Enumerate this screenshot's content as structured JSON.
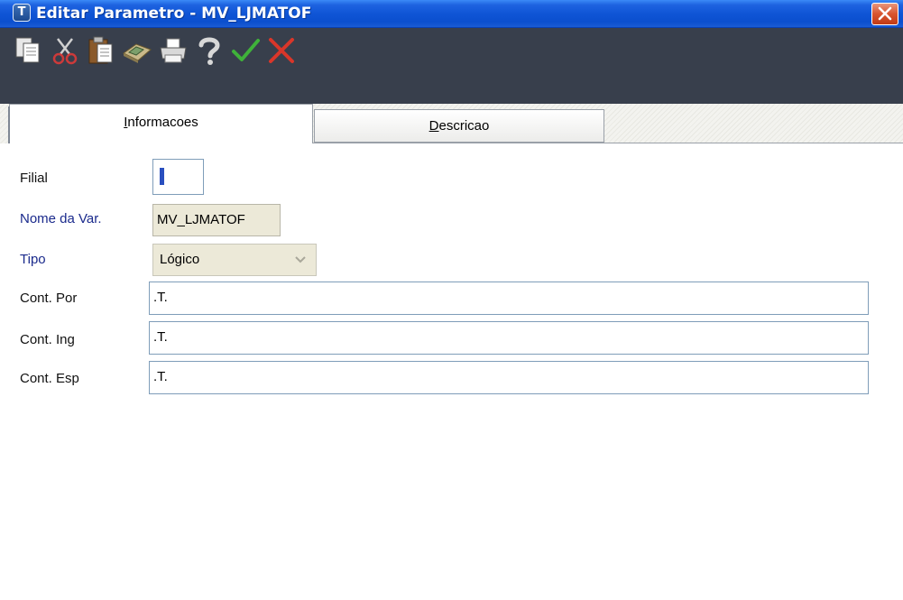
{
  "window": {
    "title": "Editar Parametro - MV_LJMATOF",
    "app_icon_glyph": "T"
  },
  "toolbar": {
    "buttons": [
      {
        "name": "copy-icon"
      },
      {
        "name": "cut-icon"
      },
      {
        "name": "paste-icon"
      },
      {
        "name": "calculator-icon"
      },
      {
        "name": "print-icon"
      },
      {
        "name": "help-icon"
      },
      {
        "name": "confirm-icon",
        "color": "#3fb23a"
      },
      {
        "name": "cancel-icon",
        "color": "#d9362a"
      }
    ]
  },
  "tabs": [
    {
      "label_pre": "",
      "label_mnemonic": "I",
      "label_post": "nformacoes",
      "active": true
    },
    {
      "label_pre": "",
      "label_mnemonic": "D",
      "label_post": "escricao",
      "active": false
    }
  ],
  "form": {
    "filial": {
      "label": "Filial",
      "value": ""
    },
    "nome_var": {
      "label": "Nome da Var.",
      "value": "MV_LJMATOF"
    },
    "tipo": {
      "label": "Tipo",
      "value": "Lógico"
    },
    "cont_por": {
      "label": "Cont. Por",
      "value": ".T."
    },
    "cont_ing": {
      "label": "Cont. Ing",
      "value": ".T."
    },
    "cont_esp": {
      "label": "Cont. Esp",
      "value": ".T."
    }
  },
  "colors": {
    "titlebar": "#0f55d6",
    "toolbar": "#383f4c",
    "required_label": "#1a2a8c",
    "readonly_field": "#ece9d8",
    "field_border": "#7f9db9"
  }
}
